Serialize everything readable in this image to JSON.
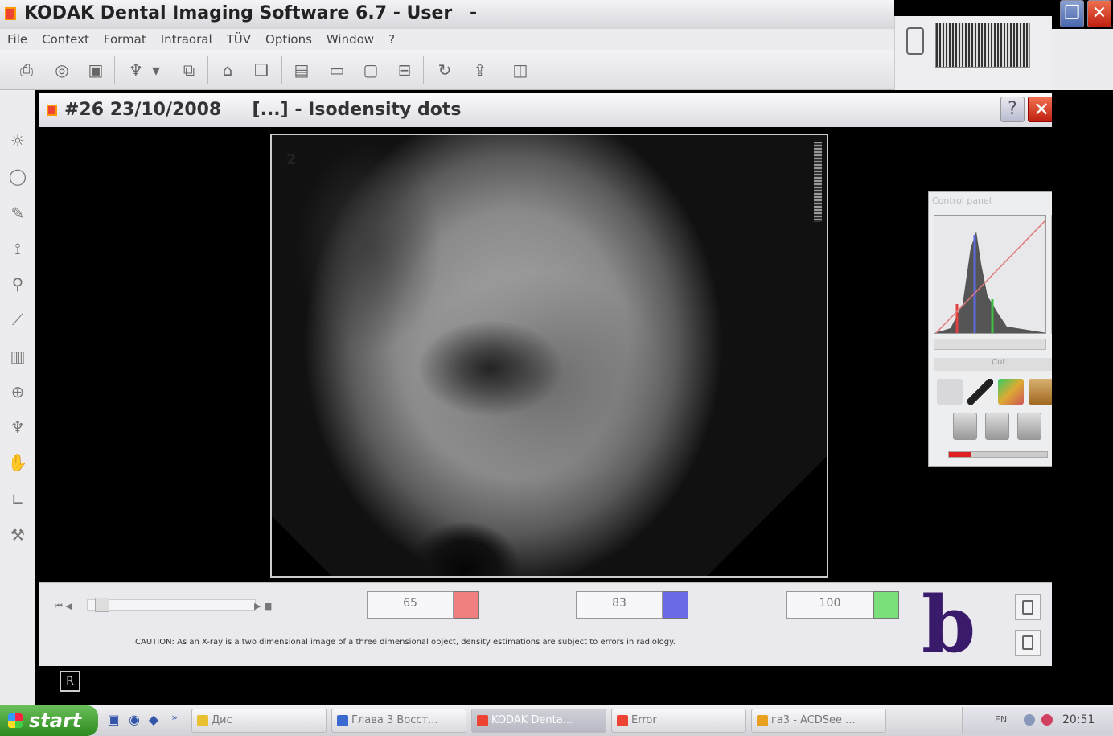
{
  "app": {
    "title": "KODAK Dental Imaging Software 6.7 - User",
    "title_suffix": "-",
    "menu": [
      "File",
      "Context",
      "Format",
      "Intraoral",
      "TÜV",
      "Options",
      "Window",
      "?"
    ]
  },
  "toolbar": {
    "icons": [
      "printer-icon",
      "disc-icon",
      "film-icon",
      "tooth-icon",
      "dropdown-arrow-icon",
      "scan-icon",
      "home-icon",
      "copy-icon",
      "panel-icon",
      "panoramic-icon",
      "layout-icon",
      "tray-icon",
      "rotate-icon",
      "export-icon",
      "frame-icon"
    ]
  },
  "left_tools": [
    "brightness-icon",
    "circle-icon",
    "pen-icon",
    "measure-icon",
    "magnify-icon",
    "ruler-icon",
    "layers-icon",
    "globe-icon",
    "tooth-tool-icon",
    "hand-icon",
    "angle-icon",
    "implant-icon"
  ],
  "document": {
    "title": "#26 23/10/2008     [...] - Isodensity dots",
    "help_label": "?",
    "close_label": "✕",
    "image_marker": "2"
  },
  "control_panel": {
    "title": "Control panel",
    "button_label": "Cut",
    "progress_fraction": 0.22
  },
  "bottom_panel": {
    "values": [
      {
        "value": "65",
        "color": "#f08080"
      },
      {
        "value": "83",
        "color": "#6a6ae6"
      },
      {
        "value": "100",
        "color": "#7ae07a"
      }
    ],
    "caution": "CAUTION: As an X-ray is a two dimensional image of a three dimensional object, density estimations are subject to errors in radiology.",
    "logo_letter": "b",
    "corner_badge": "R"
  },
  "taskbar": {
    "start_label": "start",
    "tasks": [
      {
        "label": "Дис",
        "active": false,
        "icon_color": "#e8c030"
      },
      {
        "label": "Глава 3 Восст...",
        "active": false,
        "icon_color": "#3a6ad0"
      },
      {
        "label": "KODAK Denta...",
        "active": true,
        "icon_color": "#e43"
      },
      {
        "label": "Error",
        "active": false,
        "icon_color": "#e43"
      },
      {
        "label": "га3 - ACDSee ...",
        "active": false,
        "icon_color": "#e8a020"
      }
    ],
    "lang": "EN",
    "clock": "20:51"
  },
  "colors": {
    "title_bar": "#d6d6dc",
    "close_red": "#c02010",
    "start_green": "#2c8a1e"
  }
}
